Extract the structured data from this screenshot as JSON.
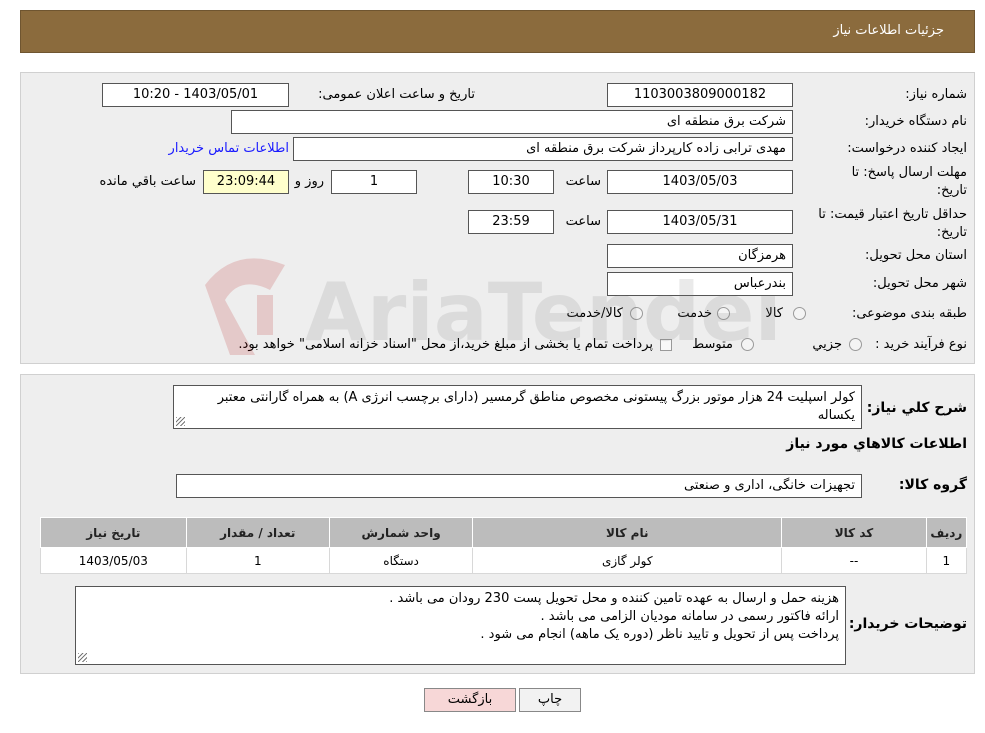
{
  "header": {
    "title": "جزئیات اطلاعات نیاز"
  },
  "form": {
    "need_number_label": "شماره نیاز:",
    "need_number": "1103003809000182",
    "announce_label": "تاریخ و ساعت اعلان عمومی:",
    "announce_value": "1403/05/01 - 10:20",
    "buyer_label": "نام دستگاه خریدار:",
    "buyer_value": "شرکت برق منطقه ای",
    "creator_label": "ایجاد کننده درخواست:",
    "creator_value": "مهدی ترابی زاده کارپرداز شرکت برق منطقه ای",
    "contact_link": "اطلاعات تماس خریدار",
    "reply_label_1": "مهلت ارسال پاسخ: تا",
    "reply_label_2": "تاریخ:",
    "reply_date": "1403/05/03",
    "time_label": "ساعت",
    "reply_time": "10:30",
    "days_value": "1",
    "days_label": "روز و",
    "remaining_time": "23:09:44",
    "remaining_label": "ساعت باقي مانده",
    "price_label_1": "حداقل تاریخ اعتبار قیمت: تا",
    "price_label_2": "تاریخ:",
    "price_date": "1403/05/31",
    "price_time": "23:59",
    "province_label": "استان محل تحویل:",
    "province_value": "هرمزگان",
    "city_label": "شهر محل تحویل:",
    "city_value": "بندرعباس",
    "category_label": "طبقه بندی موضوعی:",
    "category_options": [
      "کالا",
      "خدمت",
      "کالا/خدمت"
    ],
    "process_label": "نوع فرآیند خرید :",
    "process_options": [
      "جزيي",
      "متوسط"
    ],
    "process_note": "پرداخت تمام یا بخشی از مبلغ خرید،از محل \"اسناد خزانه اسلامی\" خواهد بود."
  },
  "details": {
    "description_label": "شرح کلي نياز:",
    "description_value": "کولر اسپلیت 24 هزار موتور بزرگ پیستونی مخصوص مناطق گرمسیر (دارای برچسب انرژی A) به همراه گارانتی معتبر یکساله",
    "goods_info_title": "اطلاعات کالاهاي مورد نياز",
    "goods_group_label": "گروه کالا:",
    "goods_group_value": "تجهیزات خانگی، اداری و صنعتی",
    "table": {
      "headers": [
        "رديف",
        "کد کالا",
        "نام کالا",
        "واحد شمارش",
        "تعداد / مقدار",
        "تاریخ نیاز"
      ],
      "rows": [
        [
          "1",
          "--",
          "کولر گازی",
          "دستگاه",
          "1",
          "1403/05/03"
        ]
      ]
    },
    "buyer_notes_label": "توضیحات خریدار:",
    "buyer_notes": [
      "هزینه حمل و ارسال به عهده تامین کننده و محل تحویل پست 230 رودان می باشد .",
      "ارائه فاکتور رسمی در سامانه مودیان الزامی می باشد .",
      "پرداخت پس از تحویل و تایید ناظر (دوره یک ماهه) انجام می شود ."
    ]
  },
  "buttons": {
    "print": "چاپ",
    "back": "بازگشت"
  },
  "watermark": {
    "text": "AriaTender.neT"
  },
  "colors": {
    "header_bg": "#8b6b3d",
    "link": "#1a1aff",
    "back_button": "#f7d7d7"
  }
}
